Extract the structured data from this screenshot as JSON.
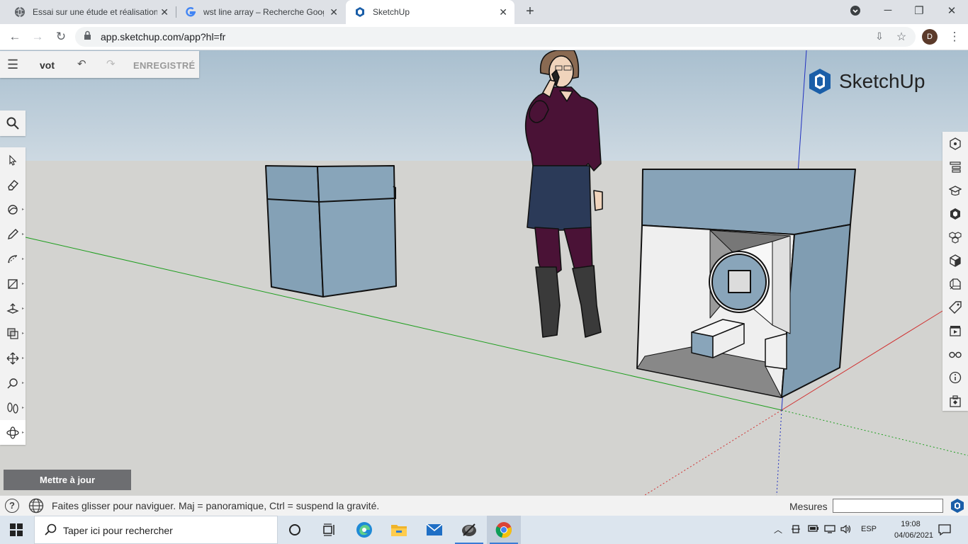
{
  "browser": {
    "tabs": [
      {
        "title": "Essai sur une étude et réalisation",
        "icon": "globe-icon",
        "active": false
      },
      {
        "title": "wst line array – Recherche Googl",
        "icon": "google-icon",
        "active": false
      },
      {
        "title": "SketchUp",
        "icon": "sketchup-icon",
        "active": true
      }
    ],
    "url": "app.sketchup.com/app?hl=fr",
    "profile_initial": "D"
  },
  "sketchup": {
    "model_title": "vot",
    "save_status": "ENREGISTRÉ",
    "logo_text": "SketchUp",
    "update_button": "Mettre à jour",
    "left_tools": [
      "select-tool",
      "eraser-tool",
      "paint-bucket-tool",
      "pencil-tool",
      "arc-tool",
      "rectangle-tool",
      "push-pull-tool",
      "offset-tool",
      "move-tool",
      "tape-measure-tool",
      "walk-tool",
      "orbit-tool"
    ],
    "right_panels": [
      "entity-info-panel",
      "outliner-panel",
      "instructor-panel",
      "materials-panel",
      "components-panel",
      "styles-panel",
      "layers-panel",
      "tags-panel",
      "scenes-panel",
      "display-panel",
      "info-panel",
      "extension-panel"
    ],
    "status_text": "Faites glisser pour naviguer. Maj = panoramique, Ctrl = suspend la gravité.",
    "measures_label": "Mesures",
    "measures_value": ""
  },
  "taskbar": {
    "search_placeholder": "Taper ici pour rechercher",
    "apps": [
      "task-view",
      "edge",
      "file-explorer",
      "mail",
      "media",
      "chrome"
    ],
    "language": "ESP",
    "time": "19:08",
    "date": "04/06/2021"
  },
  "colors": {
    "sky": "#b7c9d6",
    "ground": "#d3d3d0",
    "box_blue": "#87a3b8",
    "axis_green": "#1e9e1e",
    "axis_red": "#d03030",
    "axis_blue": "#2030c0",
    "purple": "#4a1236",
    "skirt": "#2b3a58"
  }
}
